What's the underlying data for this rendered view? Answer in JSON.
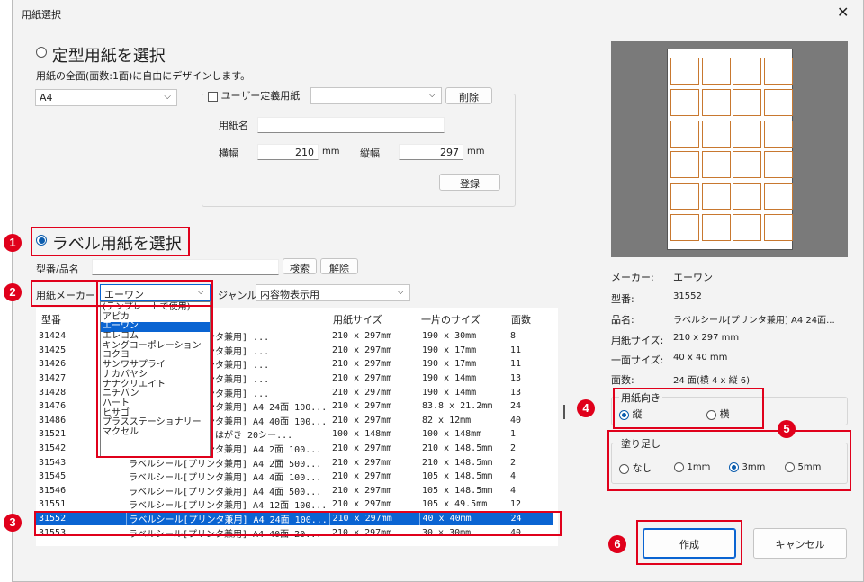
{
  "window": {
    "title": "用紙選択",
    "close_glyph": "✕"
  },
  "standard": {
    "radio_label": "定型用紙を選択",
    "description": "用紙の全面(面数:1面)に自由にデザインします。",
    "size_value": "A4",
    "user_defined_label": "ユーザー定義用紙",
    "user_defined_value": "",
    "delete_label": "削除",
    "name_label": "用紙名",
    "name_value": "",
    "width_label": "横幅",
    "width_value": "210",
    "height_label": "縦幅",
    "height_value": "297",
    "unit": "mm",
    "register_label": "登録"
  },
  "label": {
    "radio_label": "ラベル用紙を選択",
    "model_label": "型番/品名",
    "model_value": "",
    "search_label": "検索",
    "clear_label": "解除",
    "maker_label": "用紙メーカー",
    "maker_value": "エーワン",
    "genre_label": "ジャンル",
    "genre_value": "内容物表示用",
    "maker_options": [
      "(テンプレートで使用)",
      "アピカ",
      "エーワン",
      "エレコム",
      "キングコーポレーション",
      "コクヨ",
      "サンワサプライ",
      "ナカバヤシ",
      "ナナクリエイト",
      "ニチバン",
      "ハート",
      "ヒサゴ",
      "プラスステーショナリー",
      "マクセル"
    ],
    "maker_selected_index": 2
  },
  "table": {
    "headers": [
      "型番",
      "品名",
      "用紙サイズ",
      "一片のサイズ",
      "面数"
    ],
    "rows": [
      [
        "31424",
        "ラベルシール[プリンタ兼用]  ...",
        "210 x 297mm",
        "190 x 30mm",
        "8"
      ],
      [
        "31425",
        "ラベルシール[プリンタ兼用]  ...",
        "210 x 297mm",
        "190 x 17mm",
        "11"
      ],
      [
        "31426",
        "ラベルシール[プリンタ兼用]  ...",
        "210 x 297mm",
        "190 x 17mm",
        "11"
      ],
      [
        "31427",
        "ラベルシール[プリンタ兼用]  ...",
        "210 x 297mm",
        "190 x 14mm",
        "13"
      ],
      [
        "31428",
        "ラベルシール[プリンタ兼用]  ...",
        "210 x 297mm",
        "190 x 14mm",
        "13"
      ],
      [
        "31476",
        "ラベルシール[プリンタ兼用]  A4 24面 100...",
        "210 x 297mm",
        "83.8 x 21.2mm",
        "24"
      ],
      [
        "31486",
        "ラベルシール[プリンタ兼用]  A4 40面 100...",
        "210 x 297mm",
        "82 x 12mm",
        "40"
      ],
      [
        "31521",
        "マルチカードラベル はがき 20シー...",
        "100 x 148mm",
        "100 x 148mm",
        "1"
      ],
      [
        "31542",
        "ラベルシール[プリンタ兼用]  A4 2面 100...",
        "210 x 297mm",
        "210 x 148.5mm",
        "2"
      ],
      [
        "31543",
        "ラベルシール[プリンタ兼用]  A4 2面 500...",
        "210 x 297mm",
        "210 x 148.5mm",
        "2"
      ],
      [
        "31545",
        "ラベルシール[プリンタ兼用]  A4 4面 100...",
        "210 x 297mm",
        "105 x 148.5mm",
        "4"
      ],
      [
        "31546",
        "ラベルシール[プリンタ兼用]  A4 4面 500...",
        "210 x 297mm",
        "105 x 148.5mm",
        "4"
      ],
      [
        "31551",
        "ラベルシール[プリンタ兼用]  A4 12面 100...",
        "210 x 297mm",
        "105 x 49.5mm",
        "12"
      ],
      [
        "31552",
        "ラベルシール[プリンタ兼用]  A4 24面 100...",
        "210 x 297mm",
        "40 x 40mm",
        "24"
      ],
      [
        "31553",
        "ラベルシール[プリンタ兼用]  A4 40面 20...",
        "210 x 297mm",
        "30 x 30mm",
        "40"
      ]
    ],
    "selected_index": 13
  },
  "info": {
    "maker_label": "メーカー:",
    "maker_value": "エーワン",
    "model_label": "型番:",
    "model_value": "31552",
    "name_label": "品名:",
    "name_value": "ラベルシール[プリンタ兼用]  A4 24面...",
    "paper_label": "用紙サイズ:",
    "paper_value": "210 x 297 mm",
    "piece_label": "一面サイズ:",
    "piece_value": "40 x 40 mm",
    "count_label": "面数:",
    "count_value": "24 面(横 4 x 縦 6)"
  },
  "orientation": {
    "group_label": "用紙向き",
    "portrait": "縦",
    "landscape": "横",
    "selected": "portrait"
  },
  "bleed": {
    "group_label": "塗り足し",
    "options": [
      "なし",
      "1mm",
      "3mm",
      "5mm"
    ],
    "selected_index": 2
  },
  "buttons": {
    "create": "作成",
    "cancel": "キャンセル"
  },
  "callouts": [
    "1",
    "2",
    "3",
    "4",
    "5",
    "6"
  ],
  "colors": {
    "annotation_red": "#e0001b",
    "selection_blue": "#0a64d2",
    "preview_label_border": "#c8782f"
  }
}
